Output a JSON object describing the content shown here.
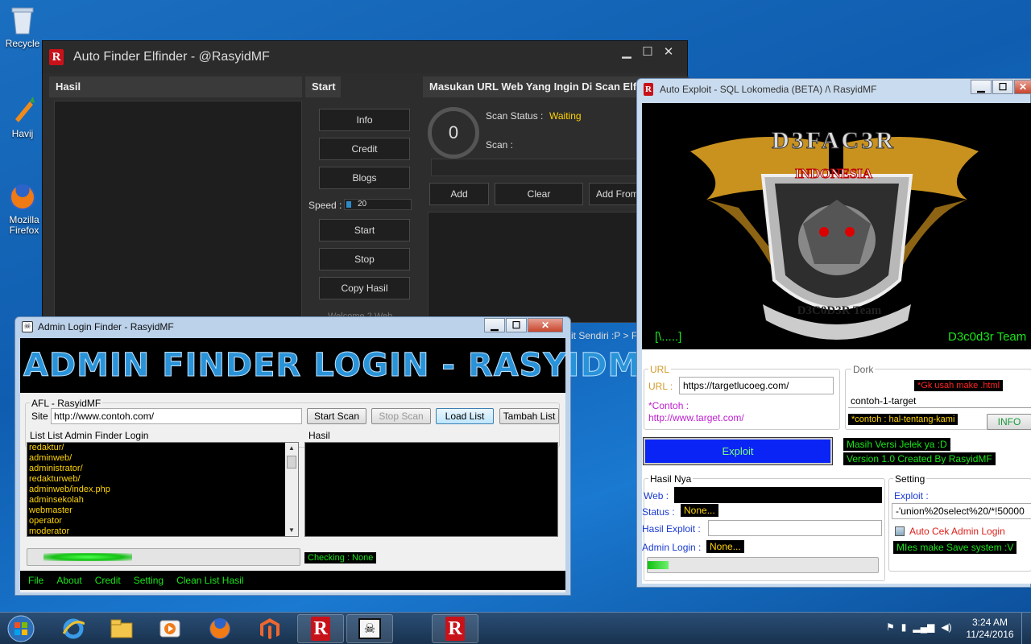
{
  "desktop": {
    "icons": [
      {
        "label": "Recycle",
        "icon": "recycle-bin-icon"
      },
      {
        "label": "Havij",
        "icon": "havij-icon"
      },
      {
        "label": "Mozilla Firefox",
        "icon": "firefox-icon"
      }
    ]
  },
  "afe": {
    "title": "Auto Finder Elfinder - @RasyidMF",
    "hasil_header": "Hasil",
    "start_header": "Start",
    "url_header": "Masukan URL Web Yang Ingin Di Scan Elf",
    "buttons": {
      "info": "Info",
      "credit": "Credit",
      "blogs": "Blogs",
      "start": "Start",
      "stop": "Stop",
      "copy": "Copy Hasil"
    },
    "speed_label": "Speed :",
    "speed_value": "20",
    "counter": "0",
    "scan_status_label": "Scan Status :",
    "scan_status_value": "Waiting",
    "scan_label": "Scan :",
    "add": "Add",
    "clear": "Clear",
    "add_from": "Add From",
    "bottom_text": "it Sendiri :P > Fi",
    "welcome": "Welcome 2 Web"
  },
  "alf": {
    "title": "Admin Login Finder - RasyidMF",
    "banner": "ADMIN FINDER LOGIN - RASYIDMF",
    "group_label": "AFL - RasyidMF",
    "site_label": "Site :",
    "site_value": "http://www.contoh.com/",
    "start_scan": "Start Scan",
    "stop_scan": "Stop Scan",
    "load_list": "Load List",
    "tambah_list": "Tambah List",
    "list_label": "List List Admin Finder Login",
    "hasil_label": "Hasil",
    "list_items": [
      "redaktur/",
      "adminweb/",
      "administrator/",
      "redakturweb/",
      "adminweb/index.php",
      "adminsekolah",
      "webmaster",
      "operator",
      "moderator"
    ],
    "checking": "Checking : None",
    "menu": [
      "File",
      "About",
      "Credit",
      "Setting",
      "Clean List Hasil"
    ]
  },
  "ae": {
    "title": "Auto Exploit - SQL Lokomedia (BETA) /\\ RasyidMF",
    "logo_top": "D3FAC3R",
    "logo_mid": "INDONESIA",
    "logo_ribbon": "D3C0D3R Team",
    "logo_left": "[\\.....]",
    "logo_right": "D3c0d3r Team",
    "url_group": "URL",
    "url_label": "URL :",
    "url_value": "https://targetlucoeg.com/",
    "contoh_label": "*Contoh :",
    "contoh_value": "http://www.target.com/",
    "dork_group": "Dork",
    "dork_note": "*Gk usah make .html",
    "dork_value": "contoh-1-target",
    "dork_example": "*contoh : hal-tentang-kami",
    "info_btn": "INFO",
    "exploit_btn": "Exploit",
    "version_note1": "Masih Versi Jelek ya :D",
    "version_note2": "Version 1.0 Created By RasyidMF",
    "hasil_group": "Hasil Nya",
    "web_label": "Web :",
    "status_label": "Status :",
    "status_value": "None...",
    "hasil_exploit_label": "Hasil Exploit :",
    "admin_login_label": "Admin Login :",
    "admin_login_value": "None...",
    "setting_group": "Setting",
    "exploit_label": "Exploit :",
    "exploit_value": "-'union%20select%20/*!50000",
    "auto_cek": "Auto Cek Admin Login",
    "save_note": "MIes make Save system :V"
  },
  "taskbar": {
    "time": "3:24 AM",
    "date": "11/24/2016",
    "items": [
      "start-orb-icon",
      "ie-icon",
      "explorer-icon",
      "media-player-icon",
      "firefox-icon",
      "magento-icon",
      "rasyid-app-icon",
      "pirate-app-icon",
      "rasyid-app-icon-2"
    ]
  },
  "colors": {
    "accent_green": "#17e617",
    "accent_yellow": "#ffd400",
    "brand_red": "#c8121a",
    "exploit_blue": "#0a24f5"
  }
}
